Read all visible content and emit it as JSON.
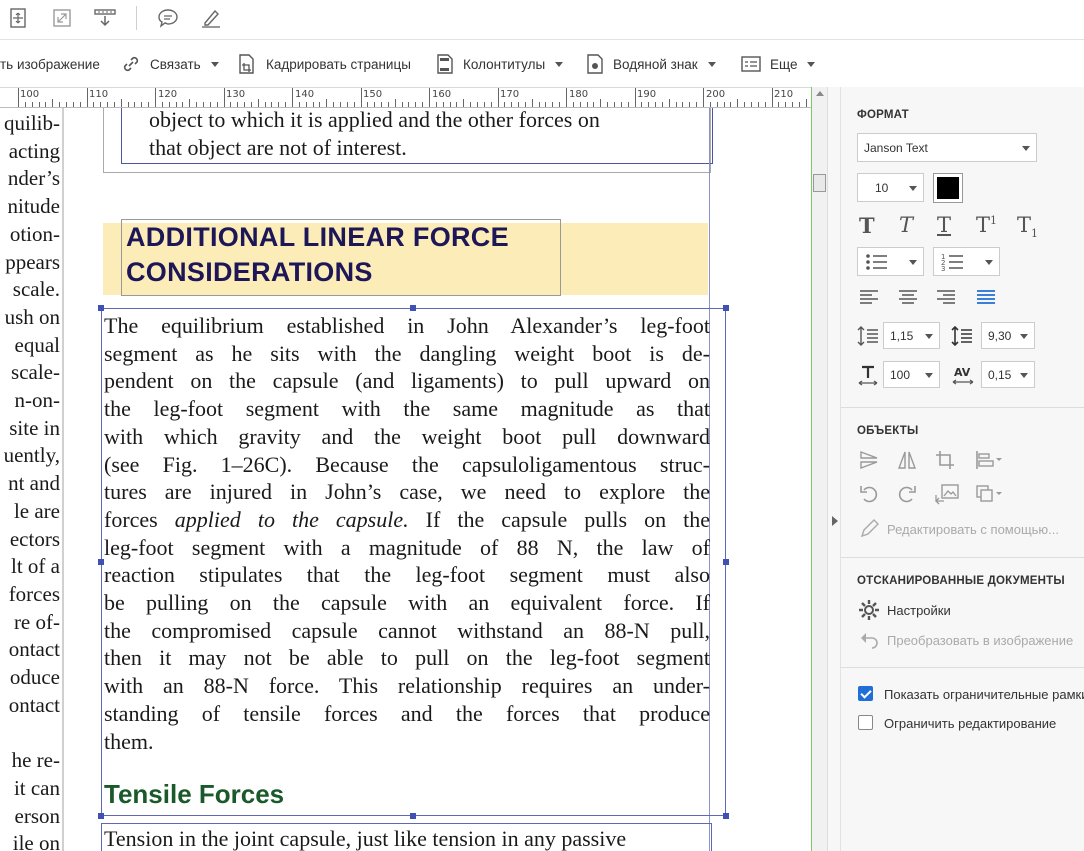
{
  "toolbar": {
    "icons": [
      "fit-page-icon",
      "full-screen-icon",
      "scroll-mode-icon",
      "comment-icon",
      "highlighter-icon"
    ]
  },
  "edit_bar": {
    "add_image": "ть изображение",
    "link": "Связать",
    "crop_pages": "Кадрировать страницы",
    "header_footer": "Колонтитулы",
    "watermark": "Водяной знак",
    "more": "Еще"
  },
  "ruler": {
    "labels": [
      "100",
      "110",
      "120",
      "130",
      "140",
      "150",
      "160",
      "170",
      "180",
      "190",
      "200",
      "210"
    ]
  },
  "document": {
    "left_column": [
      "quilib-",
      "acting",
      "nder’s",
      "nitude",
      "otion-",
      "ppears",
      "scale.",
      "ush on",
      "equal",
      "scale-",
      "n-on-",
      "site in",
      "uently,",
      "nt and",
      "le are",
      "ectors",
      "lt of a",
      "forces",
      "re of-",
      "ontact",
      "oduce",
      "ontact",
      "",
      "he re-",
      "it can",
      "erson",
      "ile on"
    ],
    "top_box_lines": [
      "object to which it is applied and the other forces on",
      "that object are not of interest."
    ],
    "heading_lines": [
      "ADDITIONAL LINEAR FORCE",
      "CONSIDERATIONS"
    ],
    "body_lines": [
      "The equilibrium established in John Alexander’s leg-foot",
      "segment as he sits with the dangling weight boot is de-",
      "pendent on the capsule (and ligaments) to pull upward on",
      "the leg-foot segment with the same magnitude as that",
      "with which gravity and the weight boot pull downward",
      "(see Fig. 1–26C). Because the capsuloligamentous struc-",
      "tures are injured in John’s case, we need to explore the",
      "forces applied to the capsule. If the capsule pulls on the",
      "leg-foot segment with a magnitude of 88 N, the law of",
      "reaction stipulates that the leg-foot segment must also",
      "be pulling on the capsule with an equivalent force. If",
      "the compromised capsule cannot withstand an 88-N pull,",
      "then it may not be able to pull on the leg-foot segment",
      "with an 88-N force. This relationship requires an under-",
      "standing of tensile forces and the forces that produce",
      "them."
    ],
    "italic_line": {
      "before": "forces ",
      "italic": "applied to the capsule.",
      "after": " If the capsule pulls on the"
    },
    "subheading": "Tensile Forces",
    "bottom_line": "Tension in the joint capsule, just like tension in any passive"
  },
  "panel": {
    "format": {
      "title": "ФОРМАТ",
      "font_family": "Janson Text",
      "font_size": "10",
      "text_color": "#000000",
      "line_spacing": "1,15",
      "paragraph_spacing": "9,30",
      "horizontal_scale": "100",
      "char_spacing": "0,15"
    },
    "objects": {
      "title": "ОБЪЕКТЫ",
      "edit_with": "Редактировать с помощью..."
    },
    "scanned": {
      "title": "ОТСКАНИРОВАННЫЕ ДОКУМЕНТЫ",
      "settings": "Настройки",
      "convert": "Преобразовать в изображение"
    },
    "options": {
      "show_bounding": "Показать ограничительные рамки",
      "show_bounding_checked": true,
      "restrict_editing": "Ограничить редактирование",
      "restrict_editing_checked": false
    }
  }
}
